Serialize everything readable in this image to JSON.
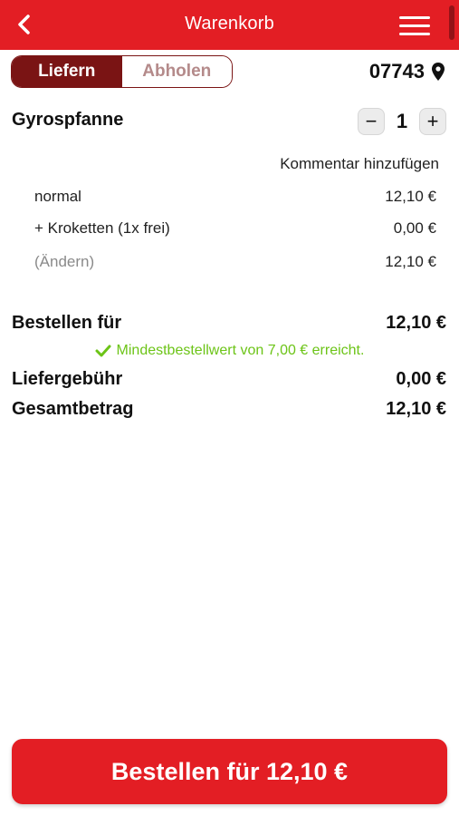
{
  "header": {
    "title": "Warenkorb",
    "back_icon": "chevron-left-icon",
    "menu_icon": "hamburger-menu-icon",
    "color": "#e31e24"
  },
  "delivery_toggle": {
    "options": [
      "Liefern",
      "Abholen"
    ],
    "selected": "Liefern",
    "active_color": "#7a1414"
  },
  "location": {
    "zip": "07743",
    "icon": "map-pin-icon"
  },
  "cart_item": {
    "name": "Gyrospfanne",
    "quantity": "1",
    "decrease_label": "−",
    "increase_label": "+",
    "comment_link": "Kommentar hinzufügen",
    "lines": [
      {
        "label": "normal",
        "price": "12,10 €"
      },
      {
        "label": "+ Kroketten (1x frei)",
        "price": "0,00 €"
      },
      {
        "label": "(Ändern)",
        "price": "12,10 €"
      }
    ]
  },
  "summary": {
    "order_for_label": "Bestellen für",
    "order_for_value": "12,10 €",
    "min_order_note": "Mindestbestellwert von 7,00 € erreicht.",
    "min_order_icon": "checkmark-icon",
    "min_order_color": "#6cc417",
    "delivery_fee_label": "Liefergebühr",
    "delivery_fee_value": "0,00 €",
    "total_label": "Gesamtbetrag",
    "total_value": "12,10 €"
  },
  "order_button": {
    "label": "Bestellen für 12,10 €"
  }
}
